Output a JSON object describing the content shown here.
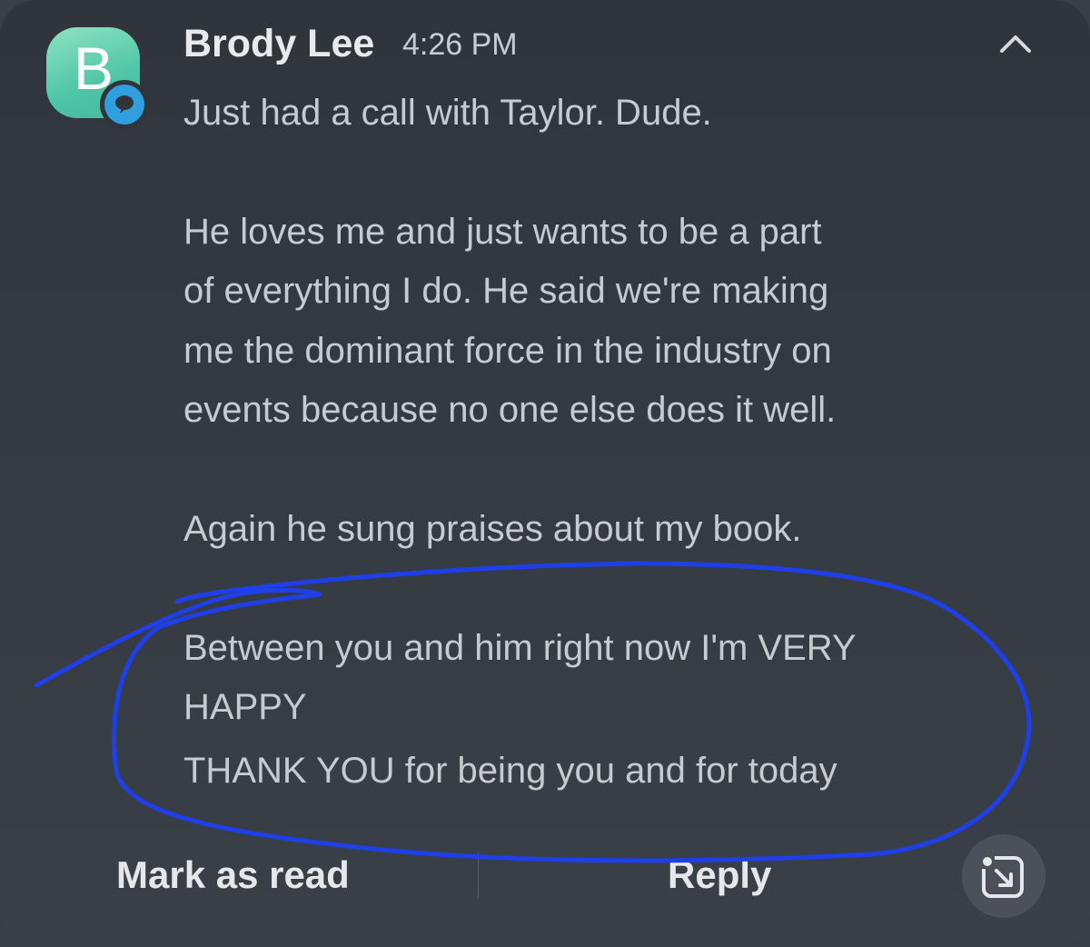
{
  "notification": {
    "avatar_letter": "B",
    "sender": "Brody Lee",
    "time": "4:26 PM",
    "message_lines": [
      "Just had a call with Taylor. Dude.",
      "He loves me and just wants to be a part",
      "of everything I do. He said we're making",
      "me the dominant force in the industry on",
      "events because no one else does it well.",
      "Again he sung praises about my book.",
      "Between you and him right now I'm VERY",
      "HAPPY",
      "THANK YOU for being you and for today"
    ],
    "app_icon": "chat-bubble-icon",
    "collapse_icon": "chevron-up-icon"
  },
  "actions": {
    "mark_read_label": "Mark as read",
    "reply_label": "Reply",
    "expand_icon": "open-in-app-icon"
  },
  "colors": {
    "avatar": "#4fc6a6",
    "app_badge": "#2f9fe0",
    "annotation_ink": "#1f3fe8",
    "background": "#353a41"
  }
}
